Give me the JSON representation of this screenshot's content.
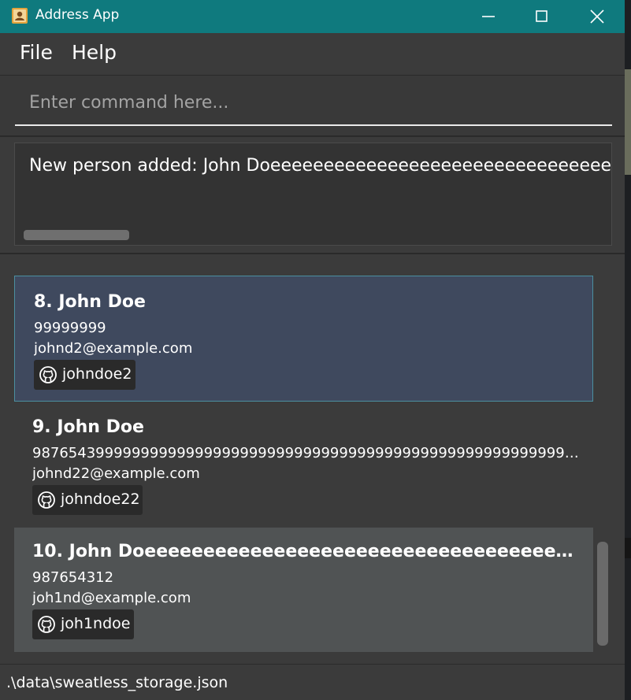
{
  "window": {
    "title": "Address App",
    "app_icon": "address-book-icon",
    "controls": [
      "minimize-icon",
      "maximize-icon",
      "close-icon"
    ]
  },
  "menu": {
    "items": [
      {
        "label": "File"
      },
      {
        "label": "Help"
      }
    ]
  },
  "command": {
    "placeholder": "Enter command here...",
    "value": ""
  },
  "result": {
    "message": "New person added: John Doeeeeeeeeeeeeeeeeeeeeeeeeeeeeeeeeeeeee"
  },
  "persons": [
    {
      "name": "8. John Doe",
      "phone": "99999999",
      "email": "johnd2@example.com",
      "tag": "johndoe2",
      "tag_icon": "github-icon",
      "selected": true
    },
    {
      "name": "9. John Doe",
      "phone": "98765439999999999999999999999999999999999999999999999999999999...",
      "email": "johnd22@example.com",
      "tag": "johndoe22",
      "tag_icon": "github-icon",
      "selected": false
    },
    {
      "name": "10. John Doeeeeeeeeeeeeeeeeeeeeeeeeeeeeeeeeeeeeeeeeeeee...",
      "phone": "987654312",
      "email": "joh1nd@example.com",
      "tag": "joh1ndoe",
      "tag_icon": "github-icon",
      "selected": false,
      "hovered": true
    }
  ],
  "status": {
    "path": ".\\data\\sweatless_storage.json"
  },
  "colors": {
    "titlebar": "#0f7a7e",
    "background": "#3b3b3b",
    "selected_card": "#3f495e",
    "selected_border": "#4b8fa0",
    "hovered_card": "#505354",
    "tag_background": "#2a2a2a"
  }
}
